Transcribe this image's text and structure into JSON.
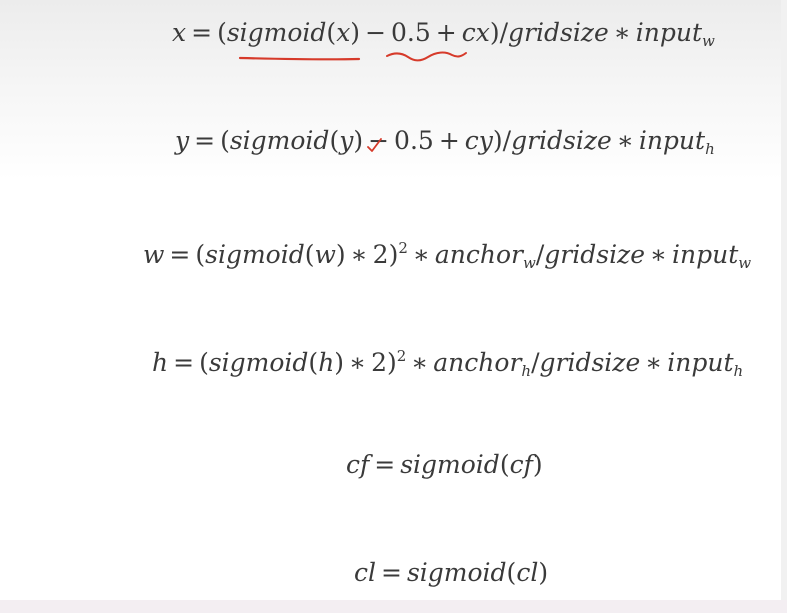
{
  "equations": [
    {
      "lhs": "x",
      "fn": "sigmoid",
      "arg": "x",
      "rest_a": "0.5",
      "rest_b": "cx",
      "div": "gridsize",
      "mul": "input",
      "sub": "w"
    },
    {
      "lhs": "y",
      "fn": "sigmoid",
      "arg": "y",
      "rest_a": "0.5",
      "rest_b": "cy",
      "div": "gridsize",
      "mul": "input",
      "sub": "h"
    },
    {
      "lhs": "w",
      "fn": "sigmoid",
      "arg": "w",
      "factor": "2",
      "exp": "2",
      "anchor": "anchor",
      "anchor_sub": "w",
      "div": "gridsize",
      "mul": "input",
      "sub": "w"
    },
    {
      "lhs": "h",
      "fn": "sigmoid",
      "arg": "h",
      "factor": "2",
      "exp": "2",
      "anchor": "anchor",
      "anchor_sub": "h",
      "div": "gridsize",
      "mul": "input",
      "sub": "h"
    },
    {
      "lhs": "cf",
      "fn": "sigmoid",
      "arg": "cf"
    },
    {
      "lhs": "cl",
      "fn": "sigmoid",
      "arg": "cl"
    }
  ],
  "colors": {
    "annotation": "#d63a2a",
    "text": "#3a3a3a"
  }
}
